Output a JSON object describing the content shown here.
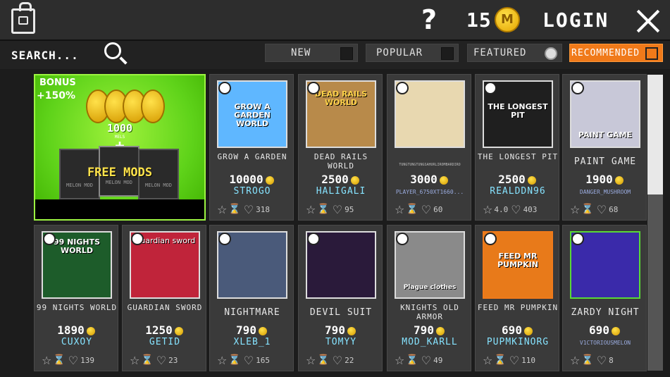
{
  "header": {
    "coins": "15",
    "coin_symbol": "M",
    "login_label": "LOGIN"
  },
  "filters": {
    "search_label": "SEARCH...",
    "buttons": [
      {
        "label": "NEW",
        "state": "off"
      },
      {
        "label": "POPULAR",
        "state": "off"
      },
      {
        "label": "FEATURED",
        "state": "on"
      },
      {
        "label": "RECOMMENDED",
        "state": "active"
      }
    ]
  },
  "bonus": {
    "badge_top": "BONUS",
    "badge_bottom": "+150%",
    "amount": "1000",
    "unit": "MELS",
    "plus": "+",
    "free_mods": "FREE MODS",
    "mod_label": "MELON MOD"
  },
  "colors": {
    "accent": "#f07a1a",
    "author": "#86e3ff",
    "bonus_green": "#5fd31a"
  },
  "cards": [
    {
      "name": "GROW A GARDEN",
      "thumb_title": "GROW A GARDEN WORLD",
      "price": "10000",
      "author": "STROGO",
      "rating": "",
      "likes": "318",
      "bg": "#5fb7ff"
    },
    {
      "name": "DEAD RAILS WORLD",
      "thumb_title": "DEAD RAILS WORLD",
      "price": "2500",
      "author": "HALIGALI",
      "rating": "",
      "likes": "95",
      "bg": "#b88a4a"
    },
    {
      "name": "TUNGTUNGTUNGSAHURLIROMBARDIRO",
      "thumb_title": "",
      "price": "3000",
      "author": "PLAYER_6750XT1660...",
      "rating": "",
      "likes": "60",
      "bg": "#e8d8b0"
    },
    {
      "name": "THE LONGEST PIT",
      "thumb_title": "THE LONGEST PIT",
      "price": "2500",
      "author": "REALDDN96",
      "rating": "4.0",
      "likes": "403",
      "bg": "#1f1f1f"
    },
    {
      "name": "PAINT GAME",
      "thumb_title": "PAINT GAME",
      "price": "1900",
      "author": "DANGER_MUSHROOM",
      "rating": "",
      "likes": "68",
      "bg": "#c8c8d8"
    },
    {
      "name": "99 NIGHTS WORLD",
      "thumb_title": "99 NIGHTS WORLD",
      "price": "1890",
      "author": "CUXOY",
      "rating": "",
      "likes": "139",
      "bg": "#1d5c2a"
    },
    {
      "name": "GUARDIAN SWORD",
      "thumb_title": "Guardian sword",
      "price": "1250",
      "author": "GETID",
      "rating": "",
      "likes": "23",
      "bg": "#c0243a"
    },
    {
      "name": "NIGHTMARE",
      "thumb_title": "",
      "price": "790",
      "author": "XLEB_1",
      "rating": "",
      "likes": "165",
      "bg": "#4a5a7a"
    },
    {
      "name": "DEVIL SUIT",
      "thumb_title": "",
      "price": "790",
      "author": "TOMYY",
      "rating": "",
      "likes": "22",
      "bg": "#2a1a3a"
    },
    {
      "name": "KNIGHTS OLD ARMOR",
      "thumb_title": "Plague clothes",
      "price": "790",
      "author": "MOD_KARLL",
      "rating": "",
      "likes": "49",
      "bg": "#8a8a8a"
    },
    {
      "name": "FEED MR PUMPKIN",
      "thumb_title": "FEED MR PUMPKIN",
      "price": "690",
      "author": "PUPMKINORG",
      "rating": "",
      "likes": "110",
      "bg": "#e87a1a"
    },
    {
      "name": "ZARDY NIGHT",
      "thumb_title": "",
      "price": "690",
      "author": "V1CTORIOUSMELON",
      "rating": "",
      "likes": "8",
      "bg": "#3a2aaa"
    }
  ]
}
